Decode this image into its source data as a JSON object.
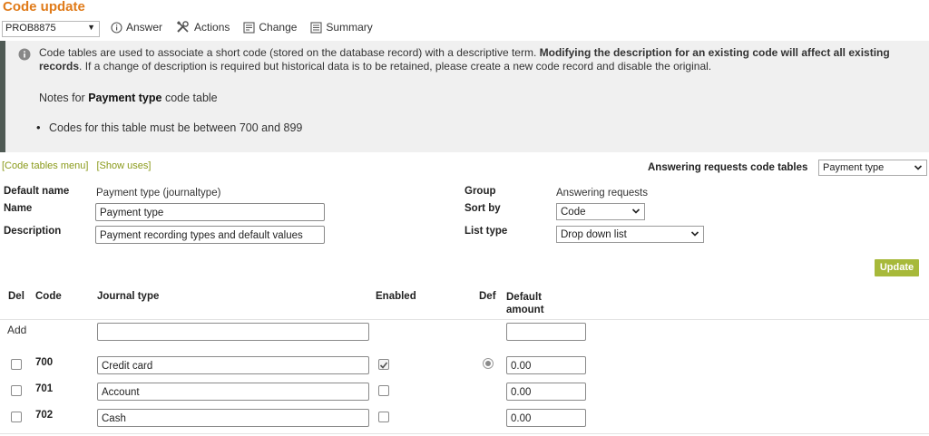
{
  "page": {
    "title": "Code update"
  },
  "record": {
    "selected": "PROB8875"
  },
  "toolbar": {
    "answer": "Answer",
    "actions": "Actions",
    "change": "Change",
    "summary": "Summary"
  },
  "info": {
    "text_plain": "Code tables are used to associate a short code (stored on the database record) with a descriptive term. ",
    "text_bold": "Modifying the description for an existing code will affect all existing records",
    "text_rest": ". If a change of description is required but historical data is to be retained, please create a new code record and disable the original.",
    "notes_prefix": "Notes for ",
    "notes_table": "Payment type",
    "notes_suffix": " code table",
    "bullet": "Codes for this table must be between 700 and 899"
  },
  "links": {
    "code_tables_menu": "[Code tables menu]",
    "show_uses": "[Show uses]"
  },
  "answering_requests": {
    "label": "Answering requests code tables",
    "selected": "Payment type"
  },
  "form": {
    "default_name_label": "Default name",
    "default_name_value": "Payment type (journaltype)",
    "name_label": "Name",
    "name_value": "Payment type",
    "description_label": "Description",
    "description_value": "Payment recording types and default values",
    "group_label": "Group",
    "group_value": "Answering requests",
    "sort_by_label": "Sort by",
    "sort_by_value": "Code",
    "list_type_label": "List type",
    "list_type_value": "Drop down list",
    "update_label": "Update"
  },
  "table": {
    "headers": {
      "del": "Del",
      "code": "Code",
      "journal_type": "Journal type",
      "enabled": "Enabled",
      "def": "Def",
      "default_amount_1": "Default",
      "default_amount_2": "amount"
    },
    "add_label": "Add",
    "rows": [
      {
        "code": "700",
        "journal_type": "Credit card",
        "enabled": true,
        "default": true,
        "amount": "0.00"
      },
      {
        "code": "701",
        "journal_type": "Account",
        "enabled": false,
        "default": false,
        "amount": "0.00"
      },
      {
        "code": "702",
        "journal_type": "Cash",
        "enabled": false,
        "default": false,
        "amount": "0.00"
      }
    ]
  },
  "colors": {
    "title": "#e07b1a",
    "link": "#8a9a1a",
    "update_button": "#a7b93a",
    "panel_bg": "#f0f0f0",
    "panel_bar": "#4f5a54"
  }
}
